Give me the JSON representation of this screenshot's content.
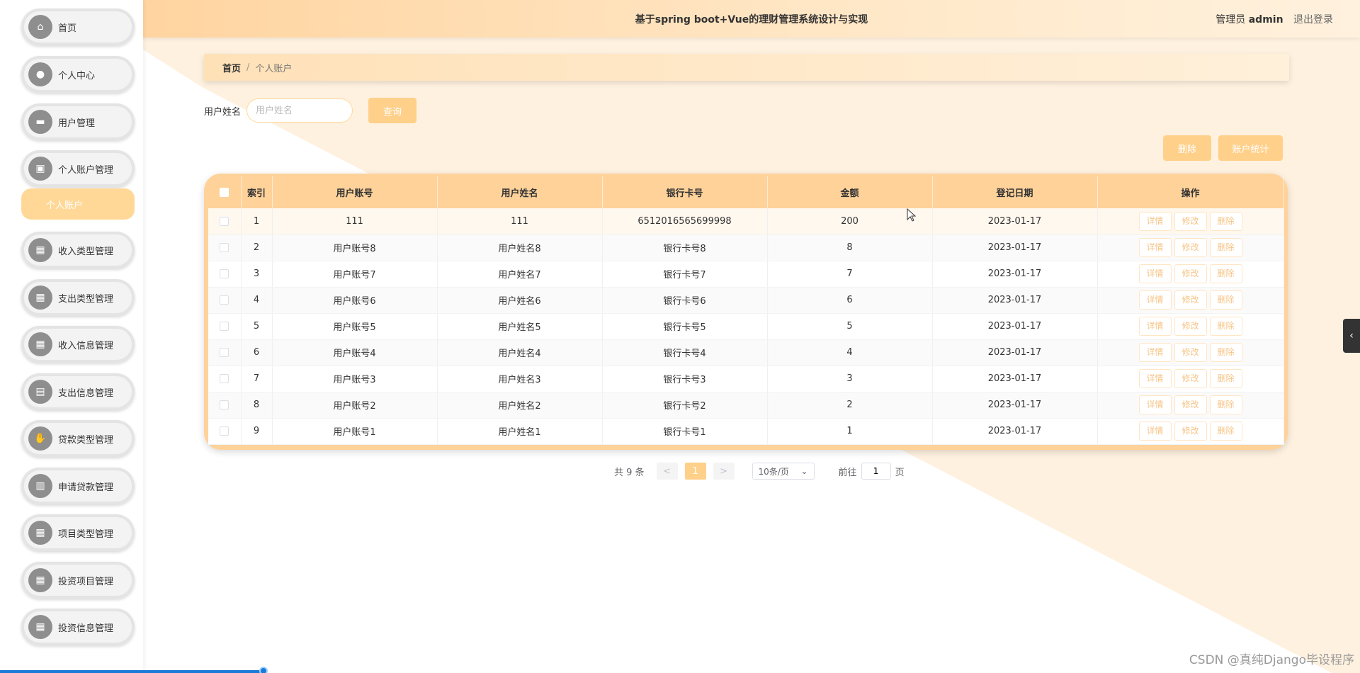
{
  "header": {
    "title": "基于spring boot+Vue的理财管理系统设计与实现",
    "role": "管理员",
    "username": "admin",
    "logout": "退出登录"
  },
  "sidebar": {
    "items": [
      {
        "label": "首页",
        "icon": "home-icon"
      },
      {
        "label": "个人中心",
        "icon": "user-icon"
      },
      {
        "label": "用户管理",
        "icon": "ticket-icon"
      },
      {
        "label": "个人账户管理",
        "icon": "briefcase-icon"
      },
      {
        "label": "收入类型管理",
        "icon": "grid-icon"
      },
      {
        "label": "支出类型管理",
        "icon": "grid-icon"
      },
      {
        "label": "收入信息管理",
        "icon": "grid-icon"
      },
      {
        "label": "支出信息管理",
        "icon": "document-icon"
      },
      {
        "label": "贷款类型管理",
        "icon": "hand-money-icon"
      },
      {
        "label": "申请贷款管理",
        "icon": "clipboard-icon"
      },
      {
        "label": "项目类型管理",
        "icon": "grid-icon"
      },
      {
        "label": "投资项目管理",
        "icon": "grid-icon"
      },
      {
        "label": "投资信息管理",
        "icon": "grid-icon"
      }
    ],
    "submenu": {
      "label": "个人账户"
    }
  },
  "breadcrumb": {
    "home": "首页",
    "separator": "/",
    "current": "个人账户"
  },
  "search": {
    "label": "用户姓名",
    "placeholder": "用户姓名",
    "value": "",
    "button": "查询"
  },
  "actions": {
    "delete": "删除",
    "stats": "账户统计"
  },
  "table": {
    "headers": [
      "索引",
      "用户账号",
      "用户姓名",
      "银行卡号",
      "金额",
      "登记日期",
      "操作"
    ],
    "row_buttons": [
      "详情",
      "修改",
      "删除"
    ],
    "rows": [
      {
        "index": "1",
        "account": "111",
        "name": "111",
        "card": "6512016565699998",
        "amount": "200",
        "date": "2023-01-17"
      },
      {
        "index": "2",
        "account": "用户账号8",
        "name": "用户姓名8",
        "card": "银行卡号8",
        "amount": "8",
        "date": "2023-01-17"
      },
      {
        "index": "3",
        "account": "用户账号7",
        "name": "用户姓名7",
        "card": "银行卡号7",
        "amount": "7",
        "date": "2023-01-17"
      },
      {
        "index": "4",
        "account": "用户账号6",
        "name": "用户姓名6",
        "card": "银行卡号6",
        "amount": "6",
        "date": "2023-01-17"
      },
      {
        "index": "5",
        "account": "用户账号5",
        "name": "用户姓名5",
        "card": "银行卡号5",
        "amount": "5",
        "date": "2023-01-17"
      },
      {
        "index": "6",
        "account": "用户账号4",
        "name": "用户姓名4",
        "card": "银行卡号4",
        "amount": "4",
        "date": "2023-01-17"
      },
      {
        "index": "7",
        "account": "用户账号3",
        "name": "用户姓名3",
        "card": "银行卡号3",
        "amount": "3",
        "date": "2023-01-17"
      },
      {
        "index": "8",
        "account": "用户账号2",
        "name": "用户姓名2",
        "card": "银行卡号2",
        "amount": "2",
        "date": "2023-01-17"
      },
      {
        "index": "9",
        "account": "用户账号1",
        "name": "用户姓名1",
        "card": "银行卡号1",
        "amount": "1",
        "date": "2023-01-17"
      }
    ]
  },
  "pagination": {
    "total": "共 9 条",
    "prev": "<",
    "current": "1",
    "next": ">",
    "page_size": "10条/页",
    "goto_label": "前往",
    "goto_value": "1",
    "goto_suffix": "页"
  },
  "watermark": "CSDN @真纯Django毕设程序",
  "colors": {
    "accent": "#ffd08a",
    "header_bg": "#ffd4a0",
    "submenu_bg": "#ffd898"
  }
}
